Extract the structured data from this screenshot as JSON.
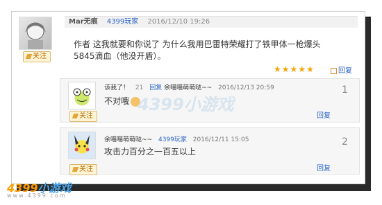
{
  "main_post": {
    "username": "Mar无痕",
    "tag": "4399玩家",
    "time": "2016/12/10 19:26",
    "follow_label": "关注",
    "text": "作者 这我就要和你说了 为什么我用巴雷特荣耀打了铁甲体一枪爆头5845滴血（他没开盾）。",
    "rating_stars": 5,
    "reply_label": "回复"
  },
  "replies": [
    {
      "username": "该我了！",
      "count": "21",
      "quoted_label": "回复",
      "quoted_user": "余喵喵萌萌哒~~",
      "time": "2016/12/13 20:59",
      "text": "不对哦",
      "follow_label": "关注",
      "reply_label": "回复",
      "floor": "1",
      "avatar_icon": "frog-avatar"
    },
    {
      "username": "余喵喵萌萌哒~~",
      "tag": "4399玩家",
      "time": "2016/12/11 15:05",
      "text": "攻击力百分之一百五以上",
      "follow_label": "关注",
      "reply_label": "回复",
      "floor": "2",
      "avatar_icon": "pikachu-avatar"
    }
  ],
  "watermark": {
    "brand_orange": "4399",
    "brand_blue": "小游戏",
    "url": "www.4399.com",
    "center": "4399小游戏"
  },
  "colors": {
    "link": "#2a63c6",
    "star": "#f5a400",
    "follow_bg": "#fff5d6"
  }
}
